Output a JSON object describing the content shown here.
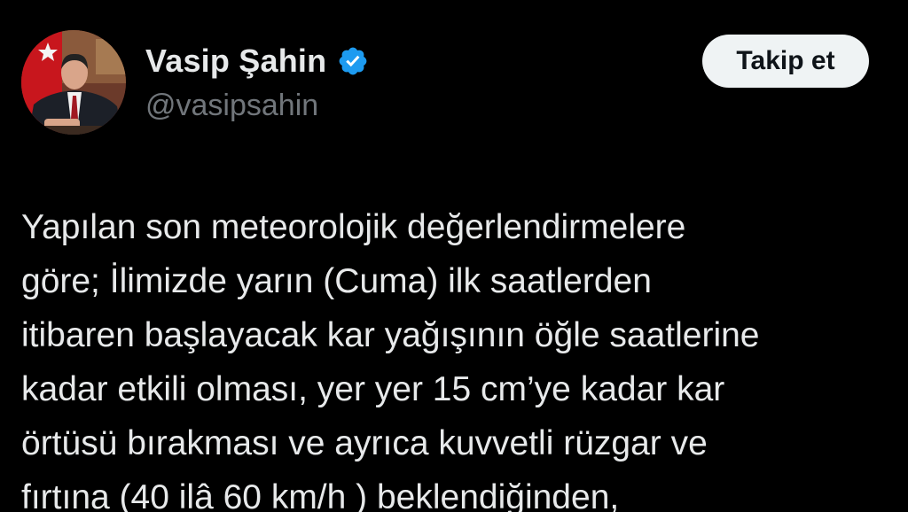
{
  "author": {
    "display_name": "Vasip Şahin",
    "handle": "@vasipsahin",
    "verified_icon": "verified-badge-icon",
    "avatar": "avatar-photo"
  },
  "follow_button": {
    "label": "Takip et"
  },
  "tweet": {
    "lines": [
      "Yapılan son meteorolojik değerlendirmelere",
      "göre; İlimizde yarın (Cuma) ilk saatlerden",
      "itibaren başlayacak kar yağışının öğle saatlerine",
      "kadar etkili olması, yer yer 15 cm’ye kadar kar",
      "örtüsü bırakması ve ayrıca kuvvetli rüzgar ve",
      "fırtına (40 ilâ 60 km/h ) beklendiğinden,"
    ]
  },
  "colors": {
    "background": "#000000",
    "text_primary": "#e7e9ea",
    "text_secondary": "#71767b",
    "verified_blue": "#1d9bf0",
    "button_bg": "#eff3f4",
    "button_text": "#0f1419"
  }
}
